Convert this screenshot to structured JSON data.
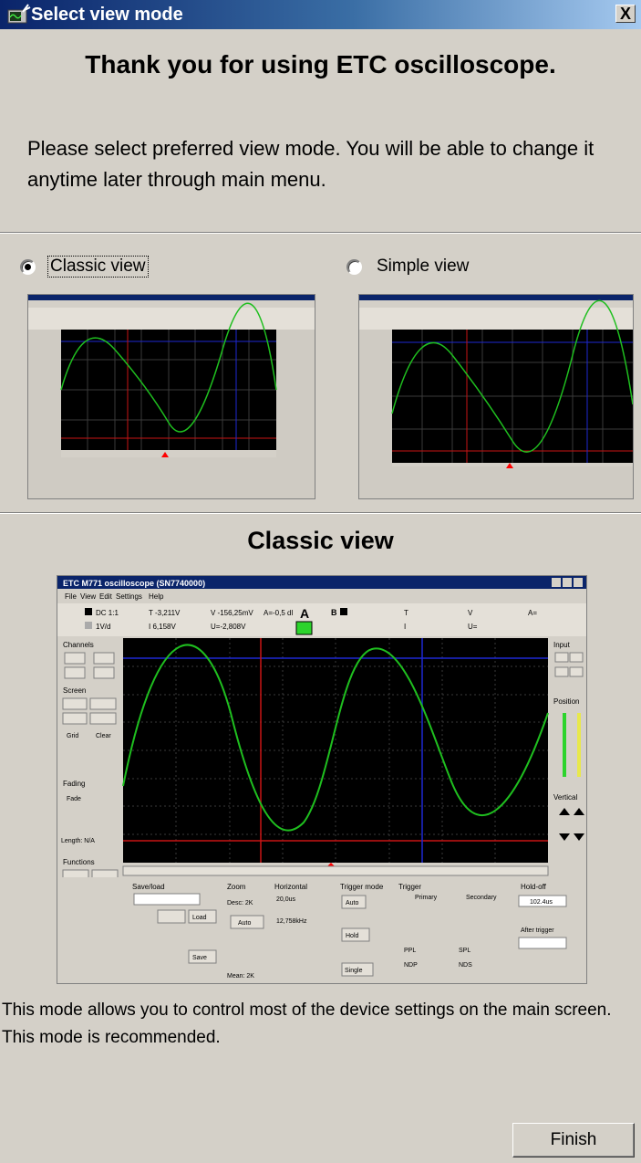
{
  "window": {
    "title": "Select view mode",
    "close_symbol": "X"
  },
  "heading": "Thank you for using ETC oscilloscope.",
  "instructions": "Please select preferred view mode. You will be able to change it anytime later through main menu.",
  "view_options": [
    {
      "label": "Classic view",
      "selected": true
    },
    {
      "label": "Simple view",
      "selected": false
    }
  ],
  "preview_title": "Classic view",
  "description": "This mode allows you to control most of the device settings on the main screen. This mode is recommended.",
  "finish_label": "Finish",
  "screenshot": {
    "title": "ETC M771 oscilloscope (SN7740000)",
    "menu": [
      "File",
      "View",
      "Edit",
      "Settings",
      "Help"
    ],
    "info": [
      "DC 1:1",
      "1V/d",
      "T -3,211V",
      "I 6,158V",
      "V -156,25mV",
      "U=-2,808V",
      "A=-0,5 dl",
      "A",
      "B",
      "T",
      "I",
      "V",
      "U=",
      "A="
    ],
    "panels": [
      "Channels",
      "Screen",
      "Fading",
      "Functions",
      "Input",
      "Position",
      "Vertical",
      "Save/load",
      "Zoom",
      "Horizontal",
      "Trigger mode",
      "Trigger",
      "Hold-off"
    ],
    "buttons": [
      "Save",
      "Load",
      "Auto",
      "Hold",
      "Single",
      "Clear",
      "Grid",
      "Fade"
    ],
    "fields": [
      "Length: N/A",
      "Primary",
      "Secondary",
      "After trigger",
      "102.4us",
      "20,0us",
      "12,758kHz",
      "NDP",
      "NDS",
      "PPL",
      "SPL",
      "Mean: 2K",
      "Desc: 2K"
    ]
  },
  "colors": {
    "face": "#d4d0c8",
    "title_start": "#0a246a",
    "title_end": "#a6caf0",
    "screen": "#000000",
    "trace": "#1fbf1f",
    "cursor_red": "#c81414",
    "cursor_blue": "#1e28d2"
  }
}
